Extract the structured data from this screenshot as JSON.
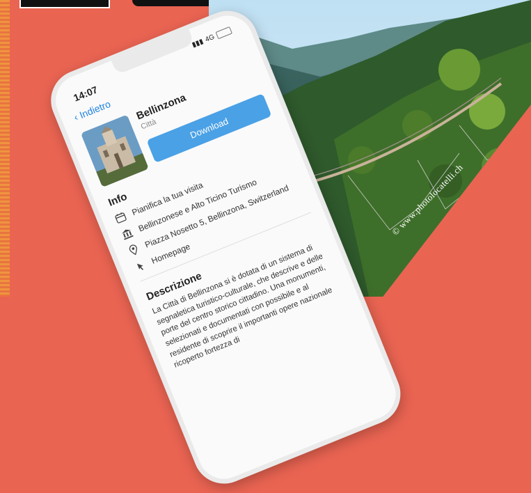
{
  "phone": {
    "time": "14:07",
    "network": "4G",
    "back_label": "Indietro",
    "place": {
      "name": "Bellinzona",
      "category": "Città"
    },
    "download_label": "Download",
    "info_heading": "Info",
    "info_rows": [
      {
        "icon": "calendar-icon",
        "text": "Pianifica la tua visita"
      },
      {
        "icon": "museum-icon",
        "text": "Bellinzonese e Alto Ticino Turismo"
      },
      {
        "icon": "location-pin-icon",
        "text": "Piazza Nosetto 5, Bellinzona, Switzerland"
      },
      {
        "icon": "cursor-icon",
        "text": "Homepage"
      }
    ],
    "description_heading": "Descrizione",
    "description_text": "La Città di Bellinzona si è dotata di un sistema di segnaletica turistico-culturale, che descrive e delle porte del centro storico cittadino. Una monumenti, selezionati e documentati con possibile e al residente di scoprire il importanti opere nazionale ricoperto fortezza di"
  },
  "credit": "© www.photolocatelli.ch"
}
